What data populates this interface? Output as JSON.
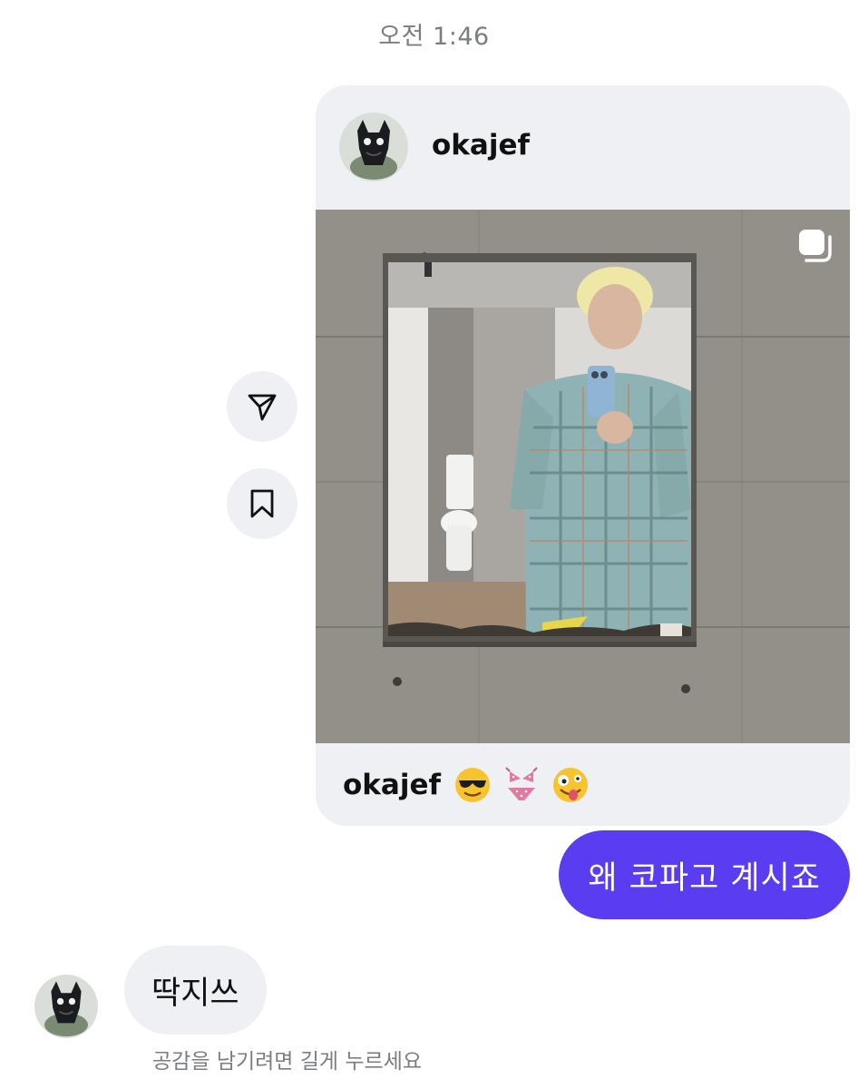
{
  "timestamp": "오전 1:46",
  "shared_post": {
    "username": "okajef",
    "caption_username": "okajef",
    "caption_emojis": [
      "sunglasses-emoji",
      "bikini-emoji",
      "zany-face-emoji"
    ],
    "multi_image_icon": "carousel-icon",
    "image_description_icon": "photo"
  },
  "actions": {
    "share_icon": "send-icon",
    "save_icon": "bookmark-icon"
  },
  "messages": {
    "sent_text": "왜 코파고 계시죠",
    "received_text": "딱지쓰"
  },
  "hint_text": "공감을 남기려면 길게 누르세요",
  "colors": {
    "sent_bubble": "#5a3df0",
    "received_bubble": "#eef0f3",
    "muted_text": "#7a7d82"
  }
}
